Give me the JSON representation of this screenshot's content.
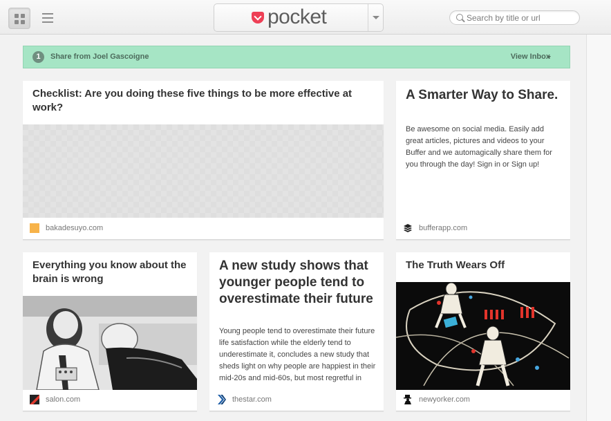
{
  "toolbar": {
    "logo_text": "pocket",
    "search_placeholder": "Search by title or url"
  },
  "share_banner": {
    "count": "1",
    "text": "Share from Joel Gascoigne",
    "link": "View Inbox"
  },
  "cards": [
    {
      "title": "Checklist: Are you doing these five things to be more effective at work?",
      "source": "bakadesuyo.com",
      "favicon_color": "#f7b34a"
    },
    {
      "title": "A Smarter Way to Share.",
      "excerpt": "Be awesome on social media. Easily add great articles, pictures and videos to your Buffer and we automagically share them for you through the day! Sign in or Sign up!",
      "source": "bufferapp.com",
      "favicon": "buffer-stack-icon"
    },
    {
      "title": "Everything you know about the brain is wrong",
      "source": "salon.com",
      "favicon": "salon-icon"
    },
    {
      "title": "A new study shows that younger people tend to overestimate their future",
      "excerpt": "Young people tend to overestimate their future life satisfaction while the elderly tend to underestimate it, concludes a new study that sheds light on why people are happiest in their mid-20s and mid-60s, but most regretful in",
      "source": "thestar.com",
      "favicon": "thestar-chevron-icon"
    },
    {
      "title": "The Truth Wears Off",
      "source": "newyorker.com",
      "favicon": "newyorker-dandy-icon"
    }
  ],
  "colors": {
    "banner_bg": "#a6e5c5",
    "pocket_red": "#ee4056"
  }
}
